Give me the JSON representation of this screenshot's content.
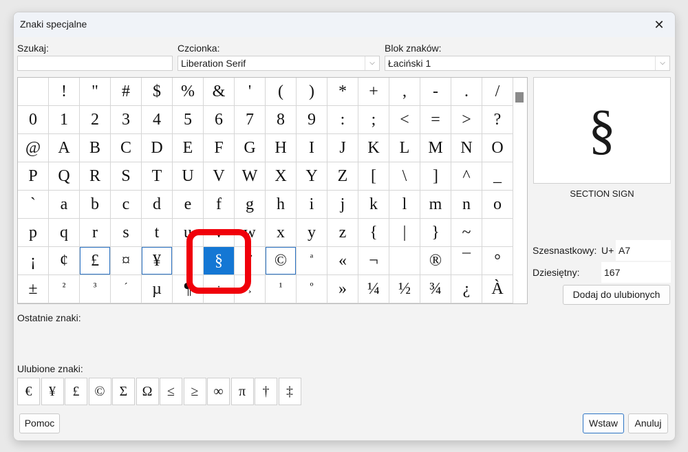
{
  "window": {
    "title": "Znaki specjalne",
    "close_glyph": "✕"
  },
  "search": {
    "label": "Szukaj:",
    "value": ""
  },
  "font": {
    "label": "Czcionka:",
    "value": "Liberation Serif"
  },
  "block": {
    "label": "Blok znaków:",
    "value": "Łaciński 1"
  },
  "grid": {
    "rows": [
      [
        " ",
        "!",
        "\"",
        "#",
        "$",
        "%",
        "&",
        "'",
        "(",
        ")",
        "*",
        "+",
        ",",
        "-",
        ".",
        "/"
      ],
      [
        "0",
        "1",
        "2",
        "3",
        "4",
        "5",
        "6",
        "7",
        "8",
        "9",
        ":",
        ";",
        "<",
        "=",
        ">",
        "?"
      ],
      [
        "@",
        "A",
        "B",
        "C",
        "D",
        "E",
        "F",
        "G",
        "H",
        "I",
        "J",
        "K",
        "L",
        "M",
        "N",
        "O"
      ],
      [
        "P",
        "Q",
        "R",
        "S",
        "T",
        "U",
        "V",
        "W",
        "X",
        "Y",
        "Z",
        "[",
        "\\",
        "]",
        "^",
        "_"
      ],
      [
        "`",
        "a",
        "b",
        "c",
        "d",
        "e",
        "f",
        "g",
        "h",
        "i",
        "j",
        "k",
        "l",
        "m",
        "n",
        "o"
      ],
      [
        "p",
        "q",
        "r",
        "s",
        "t",
        "u",
        "v",
        "w",
        "x",
        "y",
        "z",
        "{",
        "|",
        "}",
        "~",
        ""
      ],
      [
        "¡",
        "¢",
        "£",
        "¤",
        "¥",
        "¦",
        "§",
        "¨",
        "©",
        "ª",
        "«",
        "¬",
        "",
        "®",
        "¯",
        "°"
      ],
      [
        "±",
        "²",
        "³",
        "´",
        "µ",
        "¶",
        "·",
        "¸",
        "¹",
        "º",
        "»",
        "¼",
        "½",
        "¾",
        "¿",
        "À"
      ]
    ],
    "selected": "§"
  },
  "preview": {
    "glyph": "§",
    "name": "SECTION SIGN"
  },
  "hex": {
    "label": "Szesnastkowy:",
    "prefix": "U+",
    "value": "A7"
  },
  "decimal": {
    "label": "Dziesiętny:",
    "value": "167"
  },
  "add_favorite_label": "Dodaj do ulubionych",
  "recent": {
    "label": "Ostatnie znaki:"
  },
  "favorites": {
    "label": "Ulubione znaki:",
    "chars": [
      "€",
      "¥",
      "£",
      "©",
      "Σ",
      "Ω",
      "≤",
      "≥",
      "∞",
      "π",
      "†",
      "‡"
    ]
  },
  "buttons": {
    "help": "Pomoc",
    "insert": "Wstaw",
    "cancel": "Anuluj"
  },
  "colors": {
    "selection": "#1477d4",
    "highlight_ring": "#f0000a"
  }
}
